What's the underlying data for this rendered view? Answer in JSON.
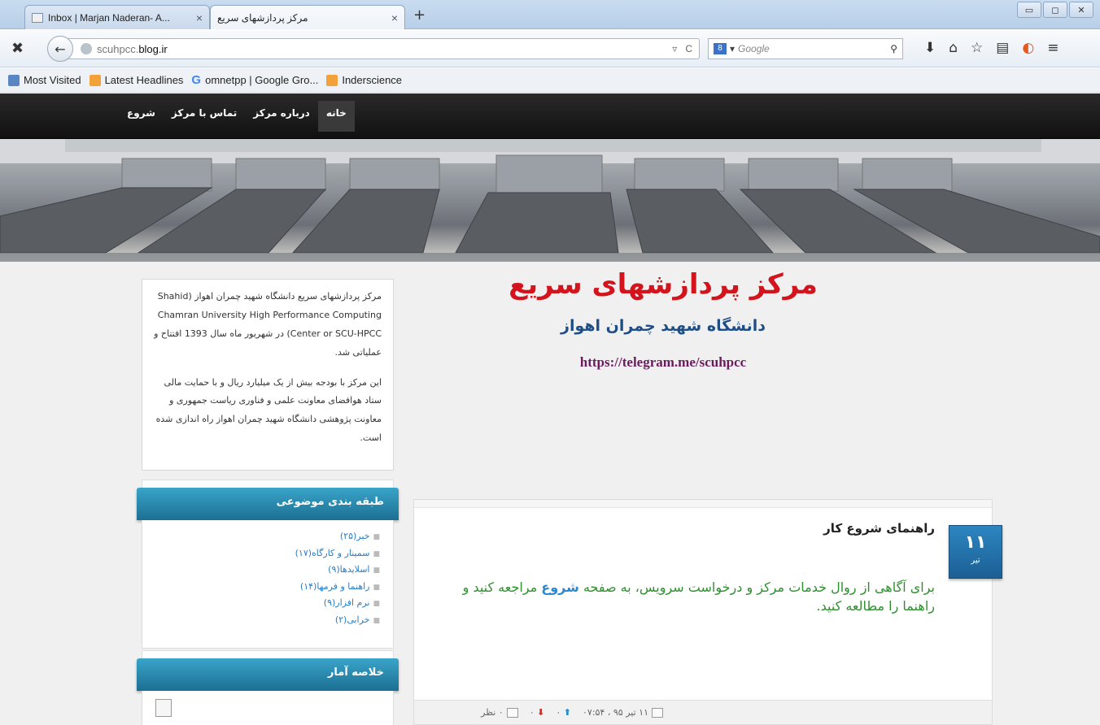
{
  "browser": {
    "tabs": [
      {
        "label": "Inbox | Marjan Naderan- A..."
      },
      {
        "label": "مرکز پردازشهای سریع"
      }
    ],
    "url_host": "scuhpcc.",
    "url_domain": "blog.ir",
    "search_placeholder": "Google",
    "bookmarks": [
      "Most Visited",
      "Latest Headlines",
      "omnetpp | Google Gro...",
      "Inderscience"
    ]
  },
  "site": {
    "menu": [
      "خانه",
      "درباره مرکز",
      "تماس با مرکز",
      "شروع"
    ],
    "title": "مرکز پردازشهای سریع",
    "subtitle": "دانشگاه شهید چمران اهواز",
    "link": "https://telegram.me/scuhpcc",
    "about_paragraph_1": "مرکز پردازشهای سریع دانشگاه شهید چمران اهواز (Shahid Chamran University High Performance Computing Center or SCU-HPCC) در شهریور ماه سال 1393 افتتاح و عملیاتی شد.",
    "about_paragraph_2": "این مرکز با بودجه بیش از یک میلیارد ریال و با حمایت مالی ستاد هوافضای معاونت علمی و فناوری ریاست جمهوری و معاونت پژوهشی دانشگاه شهید چمران اهواز راه اندازی شده است.",
    "categories_title": "طبقه بندی موضوعی",
    "categories": [
      "خبر(۲۵)",
      "سمینار و کارگاه(۱۷)",
      "اسلایدها(۹)",
      "راهنما و فرمها(۱۴)",
      "نرم افزار(۹)",
      "خرابی(۲)"
    ],
    "stats_title": "خلاصه آمار",
    "post": {
      "day": "۱۱",
      "month": "تیر",
      "title": "راهنمای شروع کار",
      "text_before": "برای آگاهی از روال خدمات مرکز و درخواست سرویس، به صفحه ",
      "text_link": "شروع",
      "text_after": " مراجعه کنید و راهنما را مطالعه کنید.",
      "date_meta": "۱۱ تیر ۹۵ ، ۰۷:۵۴",
      "likes": "۰",
      "dislikes": "۰",
      "comments": "۰ نظر"
    }
  }
}
